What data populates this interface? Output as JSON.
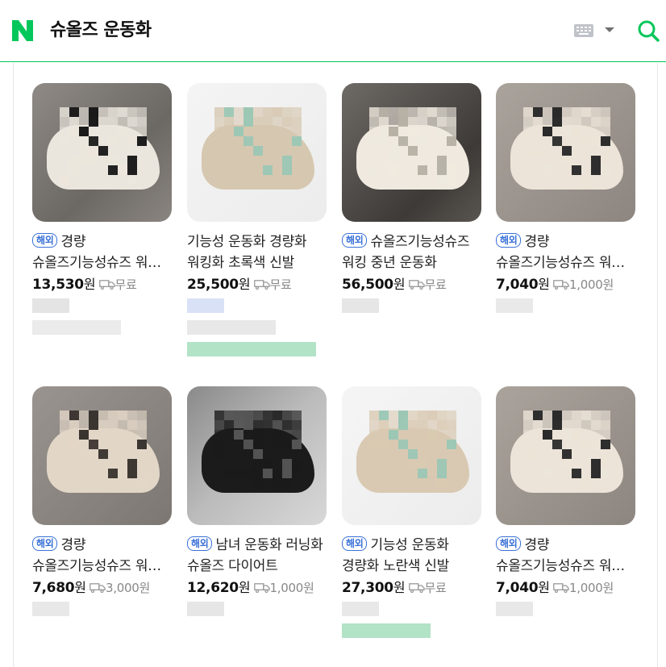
{
  "header": {
    "query": "슈올즈 운동화",
    "logo_alt": "N"
  },
  "colors": {
    "brand": "#03c75a",
    "badge": "#3a71d7"
  },
  "icons": [
    "naver-logo-icon",
    "keyboard-icon",
    "chevron-down-icon",
    "search-icon",
    "truck-icon"
  ],
  "products": [
    {
      "badge": "해외",
      "title": "경량 슈올즈기능성슈즈 워킹 운동화",
      "price": "13,530",
      "won": "원",
      "shipping": "무료"
    },
    {
      "badge": "",
      "title": "기능성 운동화 경량화 워킹화 초록색 신발",
      "price": "25,500",
      "won": "원",
      "shipping": "무료"
    },
    {
      "badge": "해외",
      "title": "슈올즈기능성슈즈 워킹 중년 운동화",
      "price": "56,500",
      "won": "원",
      "shipping": "무료"
    },
    {
      "badge": "해외",
      "title": "경량 슈올즈기능성슈즈 워킹 운동화",
      "price": "7,040",
      "won": "원",
      "shipping": "1,000원"
    },
    {
      "badge": "해외",
      "title": "경량 슈올즈기능성슈즈 워킹 운동화",
      "price": "7,680",
      "won": "원",
      "shipping": "3,000원"
    },
    {
      "badge": "해외",
      "title": "남녀 운동화 러닝화 슈올즈 다이어트",
      "price": "12,620",
      "won": "원",
      "shipping": "1,000원"
    },
    {
      "badge": "해외",
      "title": "기능성 운동화 경량화 노란색 신발",
      "price": "27,300",
      "won": "원",
      "shipping": "무료"
    },
    {
      "badge": "해외",
      "title": "경량 슈올즈기능성슈즈 워킹 운동화",
      "price": "7,040",
      "won": "원",
      "shipping": "1,000원"
    }
  ]
}
